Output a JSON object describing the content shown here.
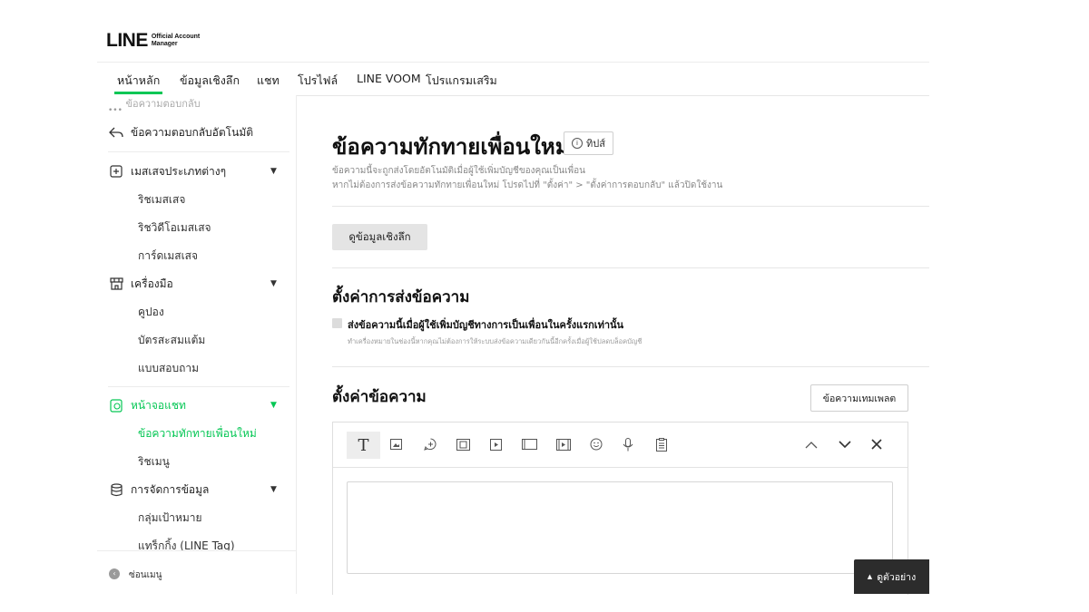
{
  "brand": {
    "logo_text": "LINE",
    "logo_sub_1": "Official Account",
    "logo_sub_2": "Manager"
  },
  "nav": {
    "tabs": [
      {
        "label": "หน้าหลัก",
        "active": true
      },
      {
        "label": "ข้อมูลเชิงลึก"
      },
      {
        "label": "แชท"
      },
      {
        "label": "โปรไฟล์"
      },
      {
        "label": "LINE VOOM"
      },
      {
        "label": "โปรแกรมเสริม"
      }
    ]
  },
  "sidebar": {
    "partial_top": "ข้อความตอบกลับ",
    "auto_reply": "ข้อความตอบกลับอัตโนมัติ",
    "groups": [
      {
        "label": "เมสเสจประเภทต่างๆ",
        "icon": "plus-box-icon",
        "items": [
          "ริชเมสเสจ",
          "ริชวิดีโอเมสเสจ",
          "การ์ดเมสเสจ"
        ]
      },
      {
        "label": "เครื่องมือ",
        "icon": "shop-icon",
        "items": [
          "คูปอง",
          "บัตรสะสมแต้ม",
          "แบบสอบถาม"
        ]
      },
      {
        "label": "หน้าจอแชท",
        "icon": "chat-screen-icon",
        "items": [
          "ข้อความทักทายเพื่อนใหม่",
          "ริชเมนู"
        ]
      },
      {
        "label": "การจัดการข้อมูล",
        "icon": "database-icon",
        "items": [
          "กลุ่มเป้าหมาย",
          "แทร็กกิ้ง (LINE Tag)"
        ]
      }
    ],
    "collapse": "ซ่อนเมนู",
    "accent": "#06c755"
  },
  "main": {
    "title": "ข้อความทักทายเพื่อนใหม่",
    "tips": "ทิปส์",
    "desc1": "ข้อความนี้จะถูกส่งโดยอัตโนมัติเมื่อผู้ใช้เพิ่มบัญชีของคุณเป็นเพื่อน",
    "desc2": "หากไม่ต้องการส่งข้อความทักทายเพื่อนใหม่ โปรดไปที่ \"ตั้งค่า\" > \"ตั้งค่าการตอบกลับ\" แล้วปิดใช้งาน",
    "insight_button": "ดูข้อมูลเชิงลึก",
    "send_section": "ตั้งค่าการส่งข้อความ",
    "checkbox_label": "ส่งข้อความนี้เมื่อผู้ใช้เพิ่มบัญชีทางการเป็นเพื่อนในครั้งแรกเท่านั้น",
    "checkbox_help": "ทำเครื่องหมายในช่องนี้หากคุณไม่ต้องการให้ระบบส่งข้อความเดียวกันนี้อีกครั้งเมื่อผู้ใช้ปลดบล็อคบัญชี",
    "message_section": "ตั้งค่าข้อความ",
    "template_button": "ข้อความเทมเพลต",
    "preview_button": "ดูตัวอย่าง"
  },
  "editor_tools": [
    "text-icon",
    "image-icon",
    "sticker-icon",
    "coupon-icon",
    "video-icon",
    "card-icon",
    "rich-video-icon",
    "emoji-icon",
    "voice-icon",
    "survey-icon",
    "move-up-icon",
    "move-down-icon",
    "delete-icon"
  ]
}
